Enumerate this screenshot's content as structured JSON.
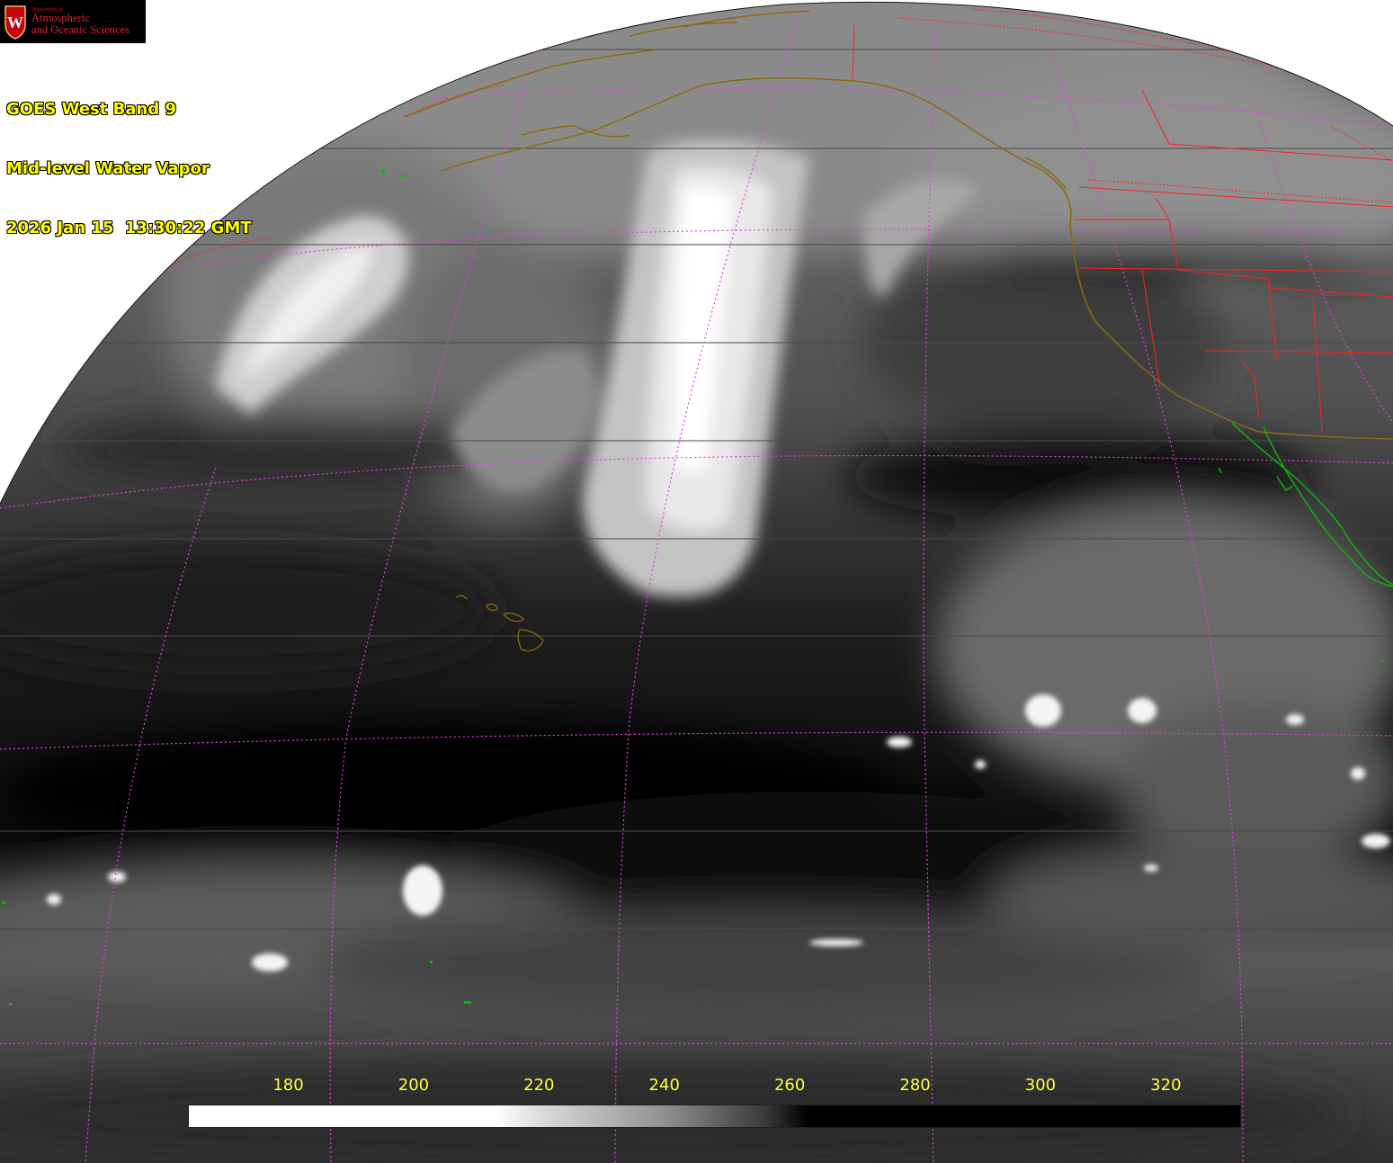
{
  "logo": {
    "department": "Department of",
    "line1": "Atmospheric",
    "line2": "and Oceanic Sciences",
    "crest_letter": "W"
  },
  "title": {
    "line1": "GOES West Band 9",
    "line2": "Mid-level Water Vapor",
    "line3": "2026 Jan 15  13:30:22 GMT"
  },
  "colorbar": {
    "ticks": [
      "180",
      "200",
      "220",
      "240",
      "260",
      "280",
      "300",
      "320"
    ],
    "tick_values": [
      180,
      200,
      220,
      240,
      260,
      280,
      300,
      320
    ],
    "range": [
      164,
      332
    ],
    "gradient": [
      {
        "value": 164,
        "color": "#ffffff"
      },
      {
        "value": 213,
        "color": "#ffffff"
      },
      {
        "value": 221,
        "color": "#d8d8d8"
      },
      {
        "value": 240,
        "color": "#909090"
      },
      {
        "value": 256,
        "color": "#3a3a3a"
      },
      {
        "value": 263,
        "color": "#000000"
      },
      {
        "value": 332,
        "color": "#000000"
      }
    ],
    "label_color": "#ffff40"
  },
  "colors": {
    "background": "#ffffff",
    "gridlines": "#e040e0",
    "state_borders": "#ff2020",
    "coastlines": "#8a6a10",
    "mexico_coast": "#10b010",
    "title_text": "#ffff00",
    "logo_red": "#d8203a"
  }
}
